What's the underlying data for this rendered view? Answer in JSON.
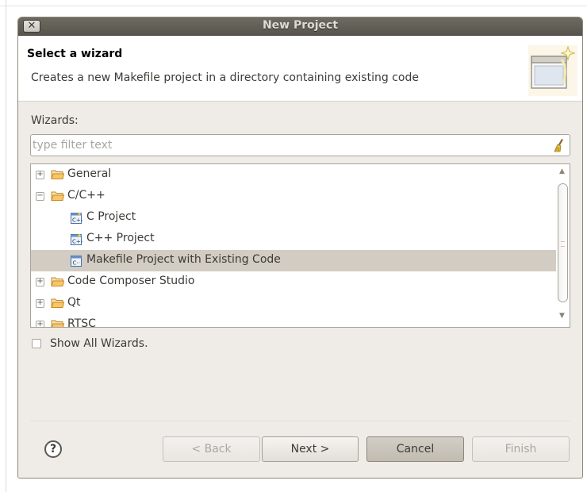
{
  "window": {
    "title": "New Project",
    "close_glyph": "✕"
  },
  "header": {
    "title": "Select a wizard",
    "description": "Creates a new Makefile project in a directory containing existing code",
    "image_icon": "new-wizard-banner-icon"
  },
  "wizards_label": "Wizards:",
  "filter": {
    "placeholder": "type filter text",
    "value": "",
    "clear_icon": "broom-icon"
  },
  "tree": {
    "items": [
      {
        "label": "General",
        "expander": "+",
        "icon": "folder-icon"
      },
      {
        "label": "C/C++",
        "expander": "−",
        "icon": "folder-icon"
      },
      {
        "label": "C Project",
        "icon": "c-project-icon"
      },
      {
        "label": "C++ Project",
        "icon": "cpp-project-icon"
      },
      {
        "label": "Makefile Project with Existing Code",
        "icon": "makefile-project-icon",
        "selected": true
      },
      {
        "label": "Code Composer Studio",
        "expander": "+",
        "icon": "folder-icon"
      },
      {
        "label": "Qt",
        "expander": "+",
        "icon": "folder-icon"
      },
      {
        "label": "RTSC",
        "expander": "+",
        "icon": "folder-icon"
      }
    ]
  },
  "show_all": {
    "label": "Show All Wizards.",
    "checked": false
  },
  "help": {
    "glyph": "?"
  },
  "buttons": {
    "back": "< Back",
    "next": "Next >",
    "cancel": "Cancel",
    "finish": "Finish"
  },
  "colors": {
    "selection": "#d2ccc3",
    "titlebar": "#5f5c55",
    "folder": "#e8a23a"
  }
}
